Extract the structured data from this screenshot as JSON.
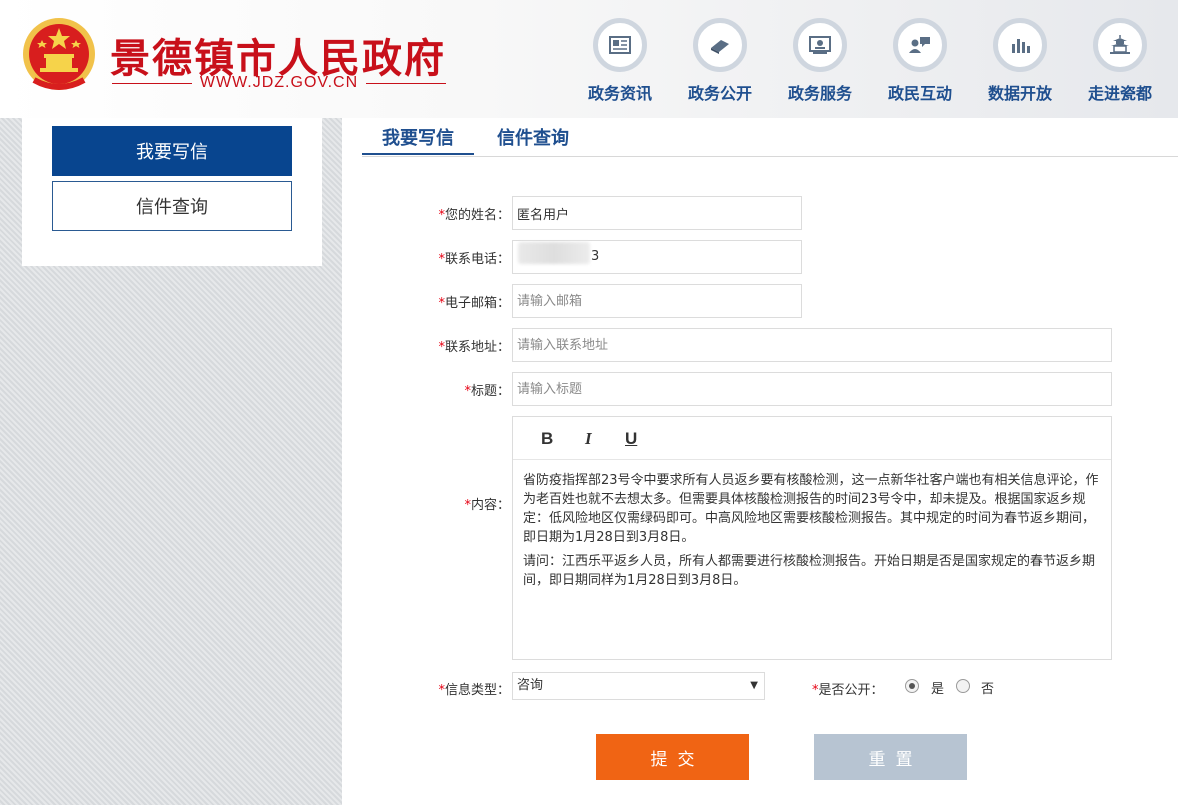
{
  "site": {
    "title": "景德镇市人民政府",
    "url": "WWW.JDZ.GOV.CN",
    "brand_color": "#c8101a"
  },
  "nav": [
    {
      "label": "政务资讯",
      "icon": "newspaper-icon"
    },
    {
      "label": "政务公开",
      "icon": "book-icon"
    },
    {
      "label": "政务服务",
      "icon": "id-card-icon"
    },
    {
      "label": "政民互动",
      "icon": "chat-user-icon"
    },
    {
      "label": "数据开放",
      "icon": "bar-chart-icon"
    },
    {
      "label": "走进瓷都",
      "icon": "pagoda-icon"
    }
  ],
  "sidebar": {
    "items": [
      {
        "label": "我要写信",
        "active": true
      },
      {
        "label": "信件查询",
        "active": false
      }
    ],
    "active_color": "#08458f"
  },
  "tabs": [
    {
      "label": "我要写信",
      "active": true
    },
    {
      "label": "信件查询",
      "active": false
    }
  ],
  "form": {
    "required_mark": "*",
    "name": {
      "label": "您的姓名：",
      "value": "匿名用户"
    },
    "phone": {
      "label": "联系电话：",
      "value_visible": "3"
    },
    "email": {
      "label": "电子邮箱：",
      "placeholder": "请输入邮箱"
    },
    "address": {
      "label": "联系地址：",
      "placeholder": "请输入联系地址"
    },
    "subject": {
      "label": "标题：",
      "placeholder": "请输入标题"
    },
    "content": {
      "label": "内容：",
      "toolbar": {
        "bold": "B",
        "italic": "I",
        "underline": "U"
      },
      "paragraphs": [
        "省防疫指挥部23号令中要求所有人员返乡要有核酸检测，这一点新华社客户端也有相关信息评论，作为老百姓也就不去想太多。但需要具体核酸检测报告的时间23号令中，却未提及。根据国家返乡规定：低风险地区仅需绿码即可。中高风险地区需要核酸检测报告。其中规定的时间为春节返乡期间，即日期为1月28日到3月8日。",
        "请问：江西乐平返乡人员，所有人都需要进行核酸检测报告。开始日期是否是国家规定的春节返乡期间，即日期同样为1月28日到3月8日。"
      ]
    },
    "info_type": {
      "label": "信息类型：",
      "selected": "咨询",
      "arrow": "▼"
    },
    "is_public": {
      "label": "是否公开：",
      "options": [
        {
          "label": "是",
          "checked": true
        },
        {
          "label": "否",
          "checked": false
        }
      ]
    }
  },
  "buttons": {
    "submit": {
      "label": "提交",
      "color": "#f06414"
    },
    "reset": {
      "label": "重置",
      "color": "#b7c4d2"
    }
  }
}
